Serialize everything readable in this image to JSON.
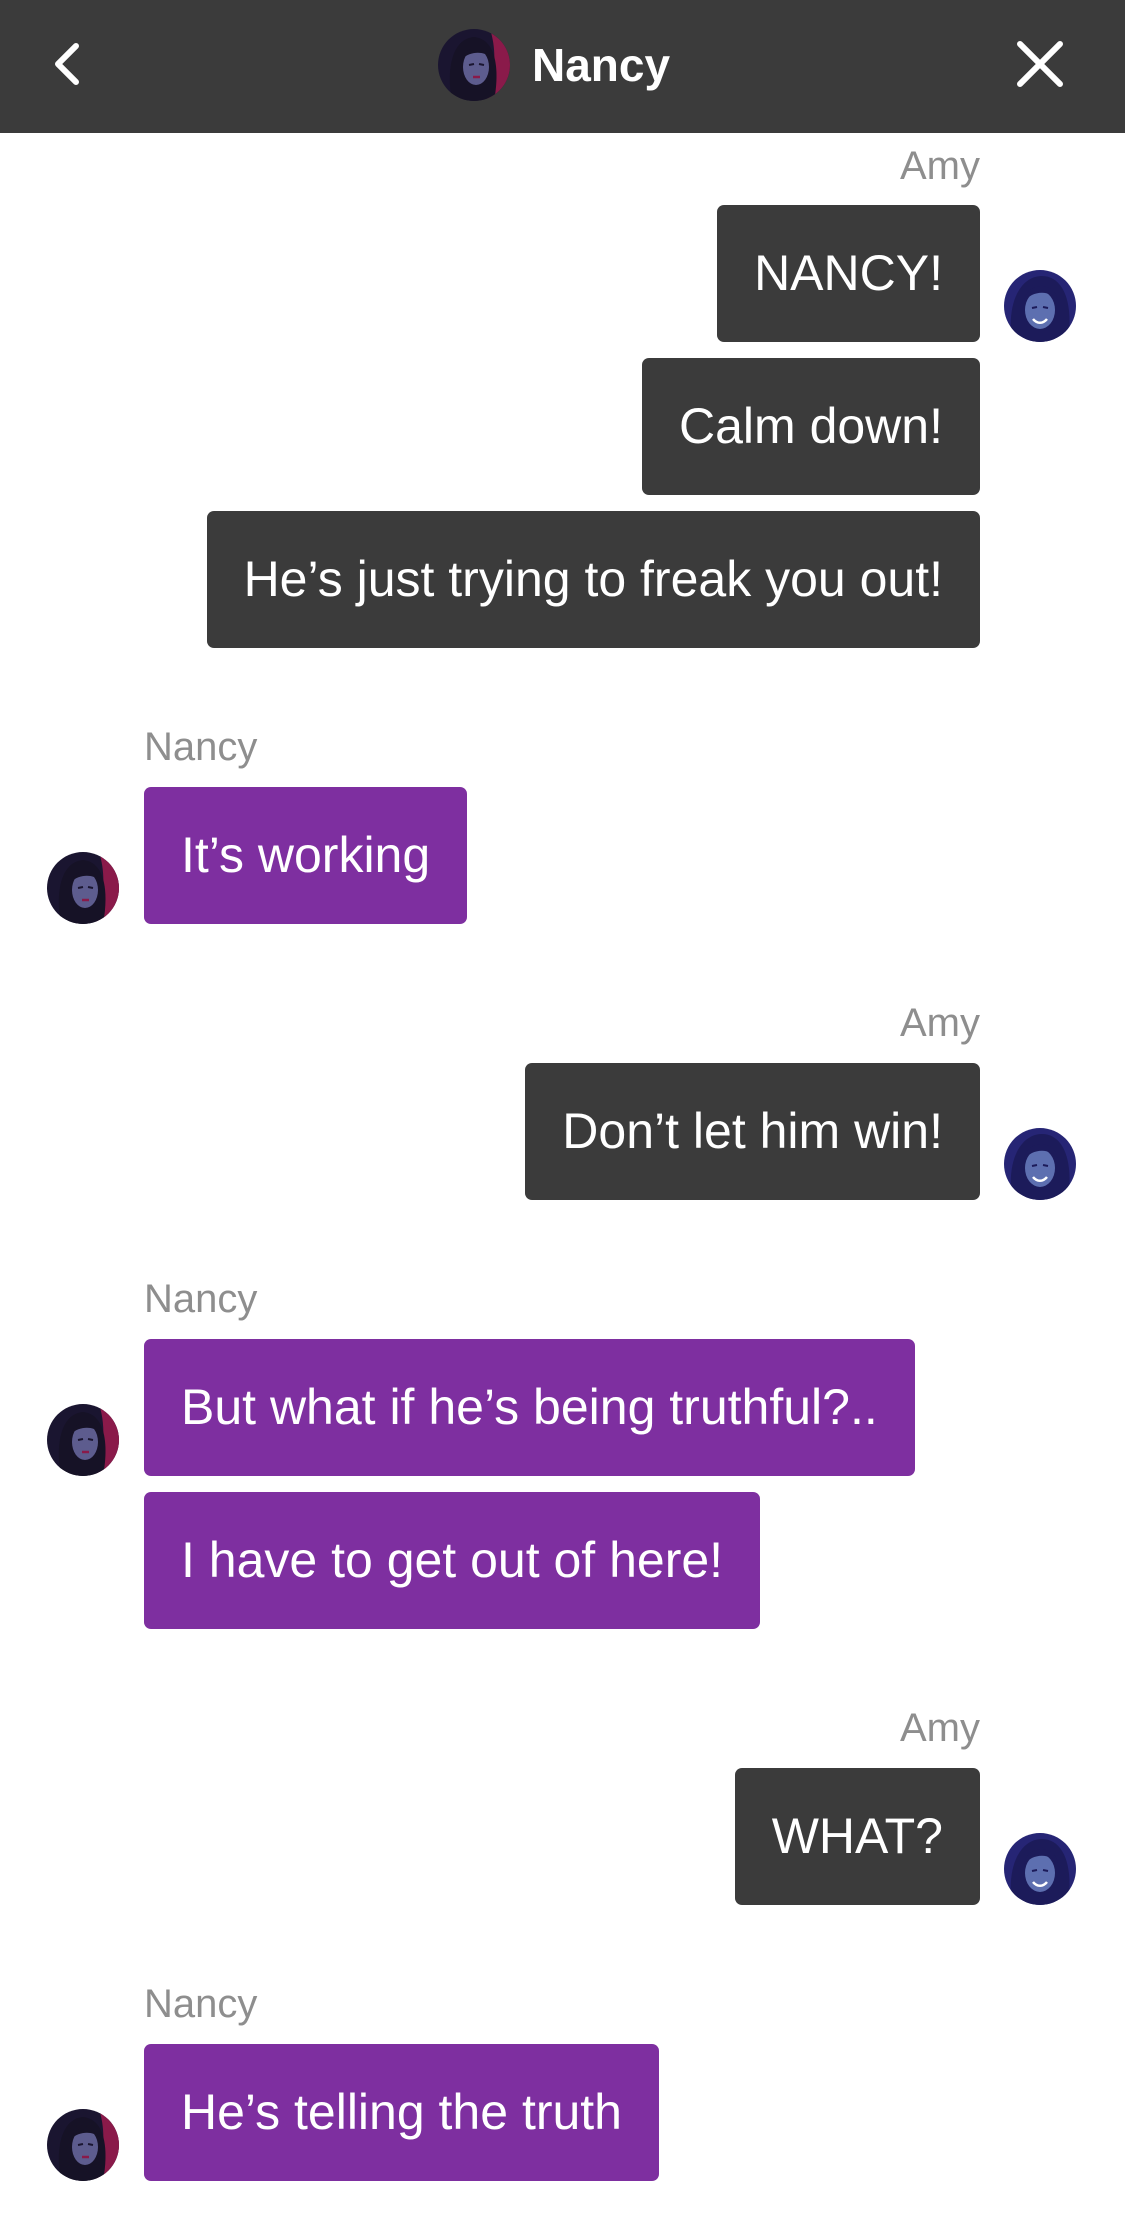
{
  "header": {
    "title": "Nancy",
    "back_icon": "chevron-left-icon",
    "close_icon": "close-icon"
  },
  "colors": {
    "header_bg": "#3b3b3b",
    "amy_bubble": "#3b3b3b",
    "nancy_bubble": "#7e2fa0",
    "sender_label": "#8e8e8e"
  },
  "messages": {
    "g1": {
      "sender": "Amy",
      "m1": "NANCY!",
      "m2": "Calm down!",
      "m3": "He’s just trying to freak you out!"
    },
    "g2": {
      "sender": "Nancy",
      "m1": "It’s working"
    },
    "g3": {
      "sender": "Amy",
      "m1": "Don’t let him win!"
    },
    "g4": {
      "sender": "Nancy",
      "m1": "But what if he’s being truthful?..",
      "m2": "I have to get out of here!"
    },
    "g5": {
      "sender": "Amy",
      "m1": "WHAT?"
    },
    "g6": {
      "sender": "Nancy",
      "m1": "He’s telling the truth"
    }
  }
}
